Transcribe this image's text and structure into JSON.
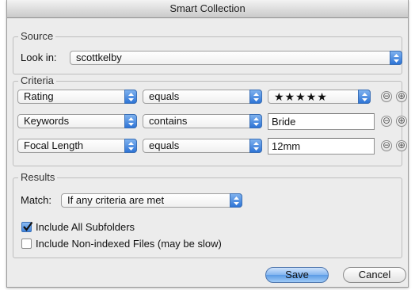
{
  "window": {
    "title": "Smart Collection"
  },
  "source": {
    "legend": "Source",
    "look_in_label": "Look in:",
    "look_in_value": "scottkelby"
  },
  "criteria": {
    "legend": "Criteria",
    "rows": [
      {
        "field": "Rating",
        "operator": "equals",
        "value": "★★★★★",
        "value_is_popup": true
      },
      {
        "field": "Keywords",
        "operator": "contains",
        "value": "Bride",
        "value_is_popup": false
      },
      {
        "field": "Focal Length",
        "operator": "equals",
        "value": "12mm",
        "value_is_popup": false
      }
    ],
    "remove_glyph": "⊖",
    "add_glyph": "⊕"
  },
  "results": {
    "legend": "Results",
    "match_label": "Match:",
    "match_value": "If any criteria are met",
    "include_subfolders": {
      "label": "Include All Subfolders",
      "checked": true
    },
    "include_nonindexed": {
      "label": "Include Non-indexed Files (may be slow)",
      "checked": false
    }
  },
  "buttons": {
    "save": "Save",
    "cancel": "Cancel"
  },
  "colors": {
    "accent": "#3e83dc",
    "window_bg": "#ececec"
  }
}
